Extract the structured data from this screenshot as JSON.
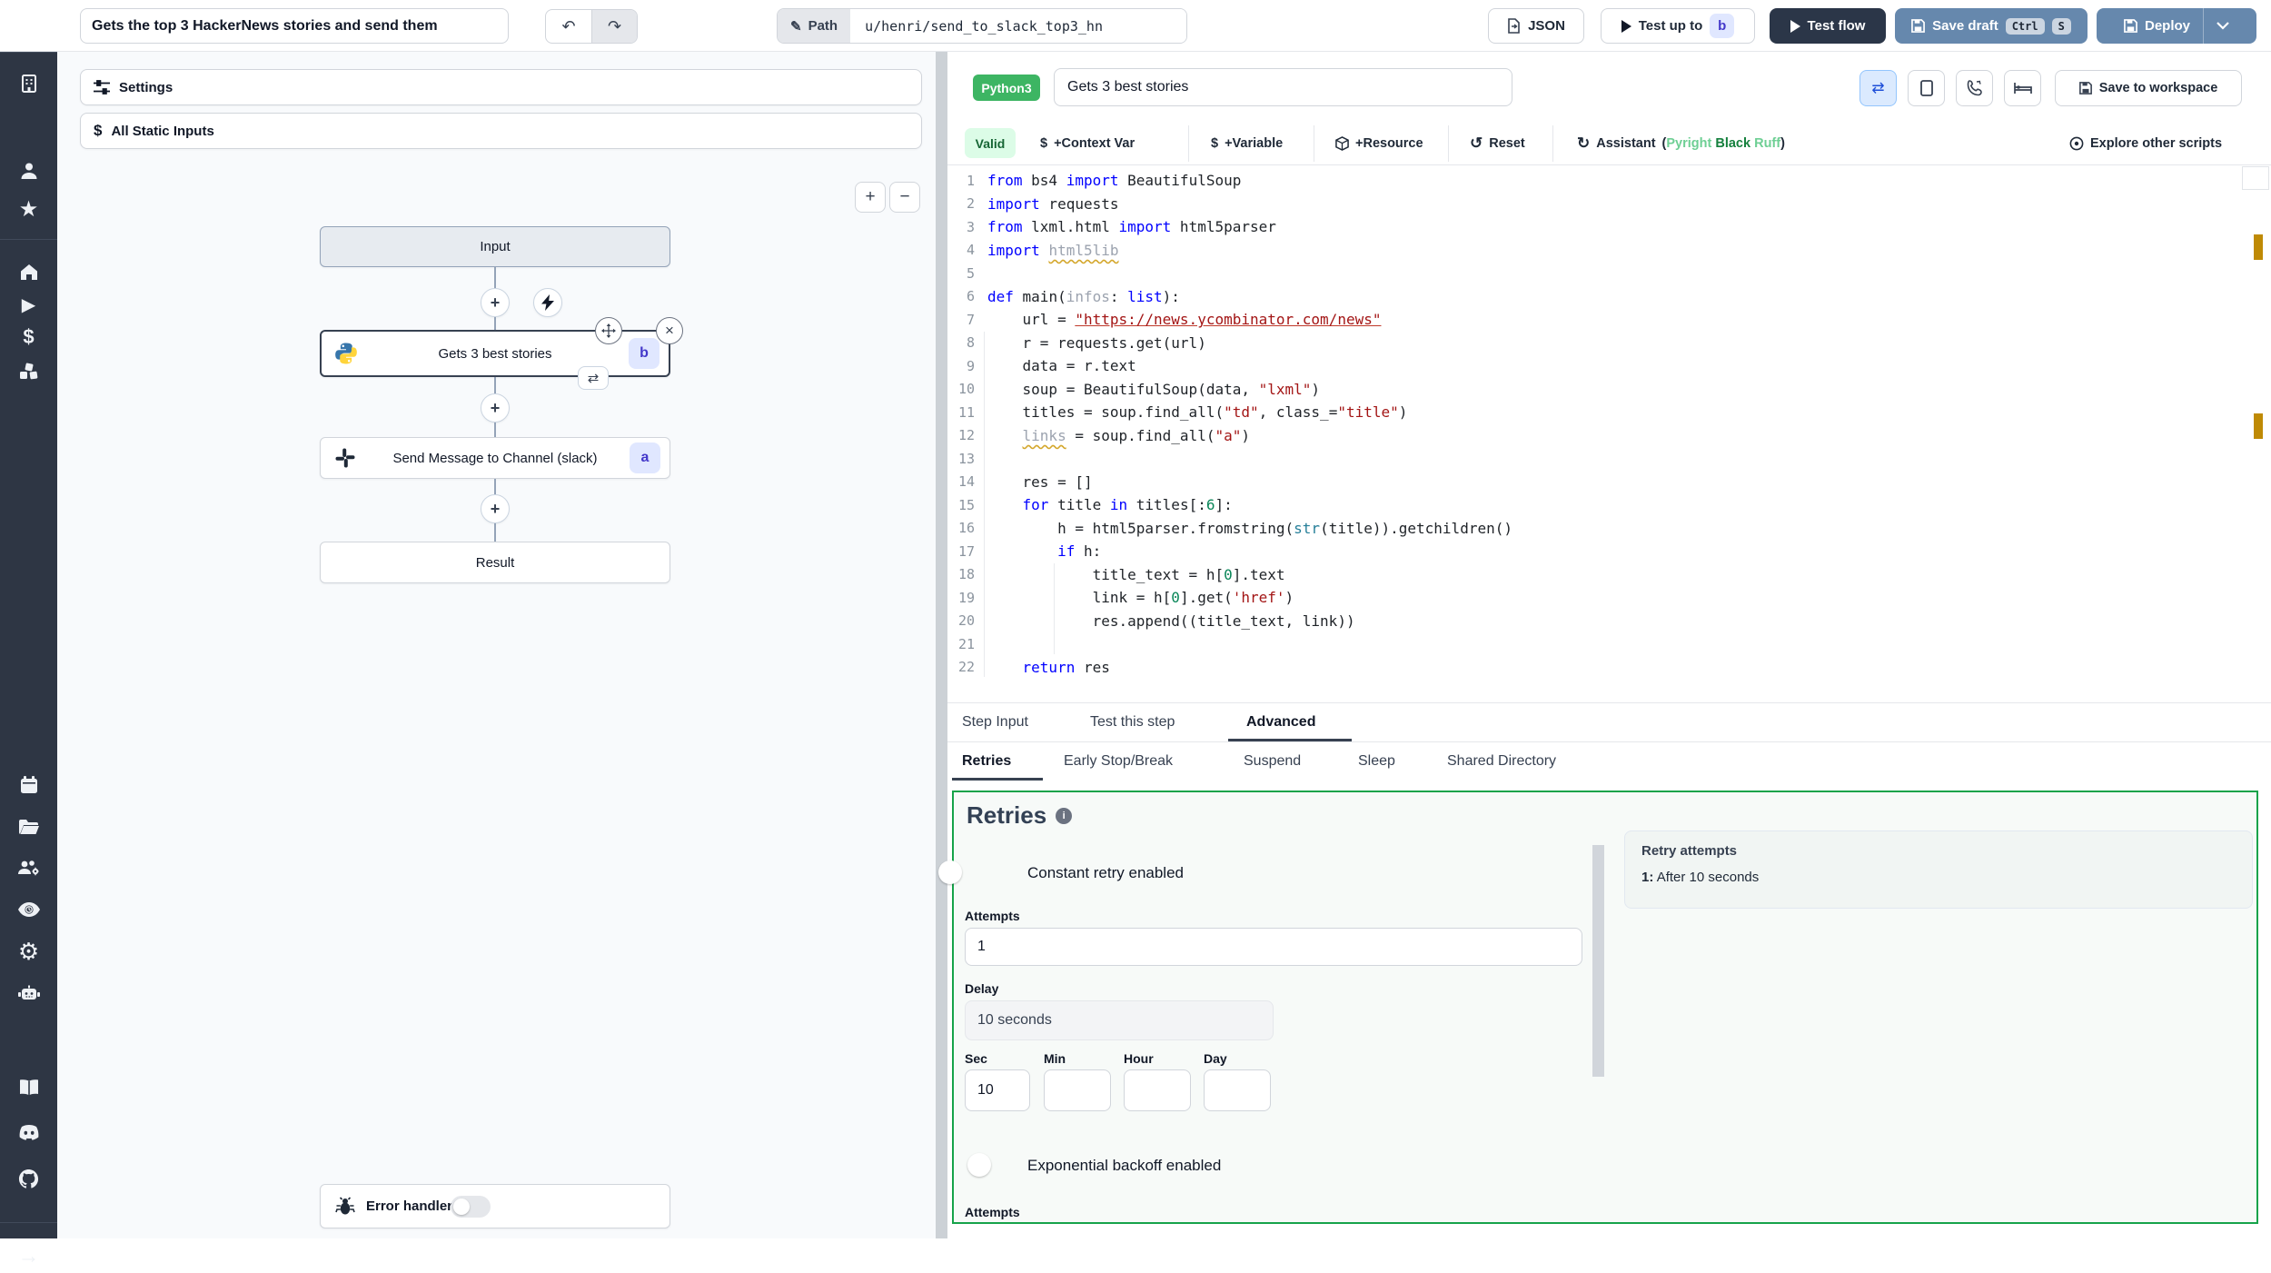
{
  "colors": {
    "sidebar_bg": "#2e3644",
    "steel_button": "#6688ad",
    "dark_button": "#2b3648",
    "lang_badge_green": "#3db563",
    "panel_border_green": "#16a34a",
    "toggle_on_blue": "#2563eb",
    "badge_indigo_bg": "#e0e7ff",
    "badge_indigo_text": "#4338ca",
    "warning_mark": "#bf8a05",
    "valid_bg": "#dcfce7",
    "valid_text": "#166534"
  },
  "sidebar": {
    "icons": [
      "windmill-logo",
      "workspace-building",
      "user",
      "favorites-star",
      "home",
      "runs-play",
      "variables-dollar",
      "resources-cubes",
      "schedules-calendar",
      "folders",
      "groups",
      "audit-logs-eye",
      "settings-gear",
      "workers-robot",
      "docs-book",
      "discord",
      "github",
      "expand-arrow"
    ]
  },
  "topbar": {
    "flow_title": "Gets the top 3 HackerNews stories and send them",
    "path_label": "Path",
    "path_value": "u/henri/send_to_slack_top3_hn",
    "json_label": "JSON",
    "test_up_to_label": "Test up to",
    "test_up_to_badge": "b",
    "test_flow_label": "Test flow",
    "save_draft_label": "Save draft",
    "save_draft_kbd1": "Ctrl",
    "save_draft_kbd2": "S",
    "deploy_label": "Deploy"
  },
  "flow": {
    "settings_label": "Settings",
    "static_inputs_label": "All Static Inputs",
    "zoom_in": "+",
    "zoom_out": "−",
    "input_label": "Input",
    "step_b_label": "Gets 3 best stories",
    "step_b_badge": "b",
    "step_a_label": "Send Message to Channel (slack)",
    "step_a_badge": "a",
    "result_label": "Result",
    "error_handler_label": "Error handler"
  },
  "editor": {
    "lang": "Python3",
    "title": "Gets 3 best stories",
    "save_workspace": "Save to workspace",
    "toolbar": {
      "valid": "Valid",
      "context_var": "+Context Var",
      "variable": "+Variable",
      "resource": "+Resource",
      "reset": "Reset",
      "assistant": "Assistant",
      "paren_open": "(",
      "pyright": "Pyright",
      "black": "Black",
      "ruff": "Ruff",
      "paren_close": ")",
      "explore": "Explore other scripts"
    },
    "code": {
      "lines": [
        {
          "n": 1,
          "toks": [
            [
              "k",
              "from"
            ],
            [
              "p",
              " bs4 "
            ],
            [
              "k",
              "import"
            ],
            [
              "p",
              " BeautifulSoup"
            ]
          ]
        },
        {
          "n": 2,
          "toks": [
            [
              "k",
              "import"
            ],
            [
              "p",
              " requests"
            ]
          ]
        },
        {
          "n": 3,
          "toks": [
            [
              "k",
              "from"
            ],
            [
              "p",
              " lxml.html "
            ],
            [
              "k",
              "import"
            ],
            [
              "p",
              " html5parser"
            ]
          ]
        },
        {
          "n": 4,
          "toks": [
            [
              "k",
              "import"
            ],
            [
              "p",
              " "
            ],
            [
              "g",
              "html5lib"
            ]
          ]
        },
        {
          "n": 5,
          "toks": []
        },
        {
          "n": 6,
          "toks": [
            [
              "k",
              "def"
            ],
            [
              "p",
              " main("
            ],
            [
              "g2",
              "infos"
            ],
            [
              "p",
              ": "
            ],
            [
              "k",
              "list"
            ],
            [
              "p",
              "):"
            ]
          ]
        },
        {
          "n": 7,
          "toks": [
            [
              "p",
              "    url = "
            ],
            [
              "u",
              "\"https://news.ycombinator.com/news\""
            ]
          ]
        },
        {
          "n": 8,
          "toks": [
            [
              "p",
              "    r = requests.get(url)"
            ]
          ]
        },
        {
          "n": 9,
          "toks": [
            [
              "p",
              "    data = r.text"
            ]
          ]
        },
        {
          "n": 10,
          "toks": [
            [
              "p",
              "    soup = BeautifulSoup(data, "
            ],
            [
              "s",
              "\"lxml\""
            ],
            [
              "p",
              ")"
            ]
          ]
        },
        {
          "n": 11,
          "toks": [
            [
              "p",
              "    titles = soup.find_all("
            ],
            [
              "s",
              "\"td\""
            ],
            [
              "p",
              ", class_="
            ],
            [
              "s",
              "\"title\""
            ],
            [
              "p",
              ")"
            ]
          ]
        },
        {
          "n": 12,
          "toks": [
            [
              "p",
              "    "
            ],
            [
              "g",
              "links"
            ],
            [
              "p",
              " = soup.find_all("
            ],
            [
              "s",
              "\"a\""
            ],
            [
              "p",
              ")"
            ]
          ]
        },
        {
          "n": 13,
          "toks": []
        },
        {
          "n": 14,
          "toks": [
            [
              "p",
              "    res = []"
            ]
          ]
        },
        {
          "n": 15,
          "toks": [
            [
              "p",
              "    "
            ],
            [
              "k",
              "for"
            ],
            [
              "p",
              " title "
            ],
            [
              "k",
              "in"
            ],
            [
              "p",
              " titles[:"
            ],
            [
              "n",
              "6"
            ],
            [
              "p",
              "]:"
            ]
          ]
        },
        {
          "n": 16,
          "toks": [
            [
              "p",
              "        h = html5parser.fromstring("
            ],
            [
              "t",
              "str"
            ],
            [
              "p",
              "(title)).getchildren()"
            ]
          ]
        },
        {
          "n": 17,
          "toks": [
            [
              "p",
              "        "
            ],
            [
              "k",
              "if"
            ],
            [
              "p",
              " h:"
            ]
          ]
        },
        {
          "n": 18,
          "toks": [
            [
              "p",
              "            title_text = h["
            ],
            [
              "n",
              "0"
            ],
            [
              "p",
              "].text"
            ]
          ]
        },
        {
          "n": 19,
          "toks": [
            [
              "p",
              "            link = h["
            ],
            [
              "n",
              "0"
            ],
            [
              "p",
              "].get("
            ],
            [
              "s",
              "'href'"
            ],
            [
              "p",
              ")"
            ]
          ]
        },
        {
          "n": 20,
          "toks": [
            [
              "p",
              "            res.append((title_text, link))"
            ]
          ]
        },
        {
          "n": 21,
          "toks": []
        },
        {
          "n": 22,
          "toks": [
            [
              "p",
              "    "
            ],
            [
              "k",
              "return"
            ],
            [
              "p",
              " res"
            ]
          ]
        }
      ]
    }
  },
  "tabs": {
    "step_input": "Step Input",
    "test_this_step": "Test this step",
    "advanced": "Advanced"
  },
  "advanced_tabs": {
    "retries": "Retries",
    "early_stop": "Early Stop/Break",
    "suspend": "Suspend",
    "sleep": "Sleep",
    "shared_directory": "Shared Directory"
  },
  "retries": {
    "title": "Retries",
    "info_glyph": "i",
    "constant_retry_label": "Constant retry enabled",
    "attempts_label": "Attempts",
    "attempts_value": "1",
    "delay_label": "Delay",
    "delay_value": "10 seconds",
    "sec_label": "Sec",
    "min_label": "Min",
    "hour_label": "Hour",
    "day_label": "Day",
    "sec_value": "10",
    "exponential_label": "Exponential backoff enabled",
    "attempts2_label": "Attempts",
    "preview_title": "Retry attempts",
    "preview_item_prefix": "1:",
    "preview_item_text": "After 10 seconds"
  }
}
